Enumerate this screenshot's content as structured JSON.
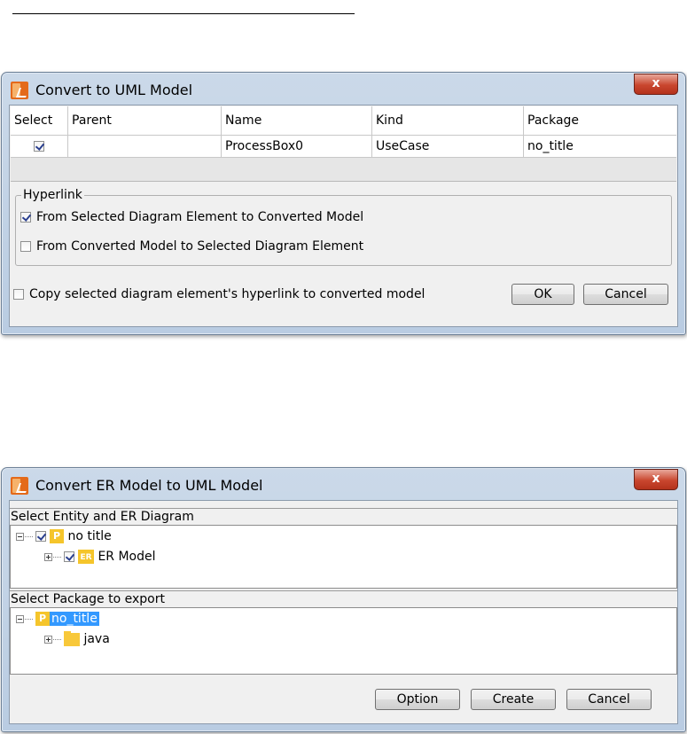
{
  "dialog1": {
    "title": "Convert to UML Model",
    "close_label": "x",
    "columns": [
      "Select",
      "Parent",
      "Name",
      "Kind",
      "Package"
    ],
    "row": {
      "selected": true,
      "parent": "",
      "name": "ProcessBox0",
      "kind": "UseCase",
      "package": "no_title"
    },
    "hyperlink": {
      "legend": "Hyperlink",
      "option1_label": "From Selected Diagram Element to Converted Model",
      "option1_checked": true,
      "option2_label": "From Converted Model to Selected Diagram Element",
      "option2_checked": false
    },
    "copy_label": "Copy selected diagram element's hyperlink to converted model",
    "copy_checked": false,
    "ok_label": "OK",
    "cancel_label": "Cancel"
  },
  "dialog2": {
    "title": "Convert ER Model to UML Model",
    "close_label": "x",
    "entity_section_label": "Select Entity and ER Diagram",
    "entity_tree": [
      {
        "label": "no title",
        "icon": "package-icon",
        "icon_text": "P",
        "checked": true,
        "expander": "minus"
      },
      {
        "label": "ER Model",
        "icon": "er-model-icon",
        "icon_text": "ER",
        "checked": true,
        "expander": "plus"
      }
    ],
    "package_section_label": "Select Package to export",
    "package_tree": [
      {
        "label": "no_title",
        "icon": "package-icon",
        "icon_text": "P",
        "expander": "minus",
        "selected": true
      },
      {
        "label": "java",
        "icon": "folder-icon",
        "expander": "plus",
        "selected": false
      }
    ],
    "option_label": "Option",
    "create_label": "Create",
    "cancel_label": "Cancel"
  },
  "colors": {
    "selection": "#3399ff",
    "close_button": "#c9462e",
    "package_icon": "#f5c52b"
  }
}
